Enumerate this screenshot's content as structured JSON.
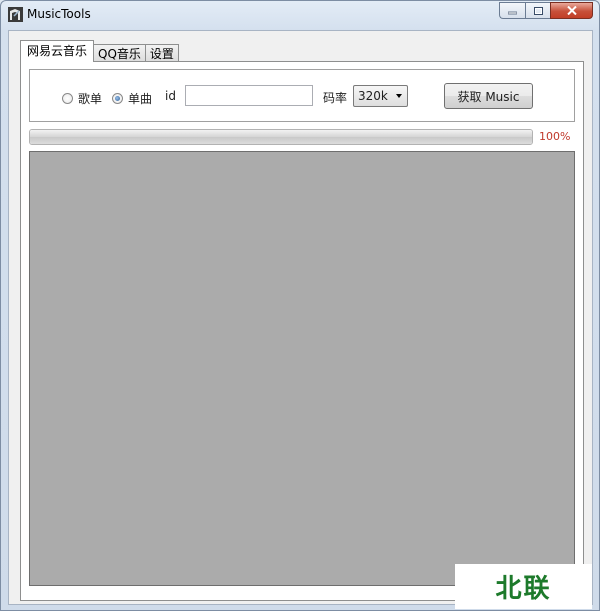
{
  "window": {
    "title": "MusicTools"
  },
  "tabs": [
    {
      "label": "网易云音乐",
      "active": true
    },
    {
      "label": "QQ音乐",
      "active": false
    },
    {
      "label": "设置",
      "active": false
    }
  ],
  "form": {
    "radio_playlist": "歌单",
    "radio_single": "单曲",
    "selected_mode": "单曲",
    "id_label": "id",
    "id_value": "",
    "bitrate_label": "码率",
    "bitrate_value": "320k",
    "fetch_button": "获取 Music"
  },
  "progress": {
    "value": 100,
    "label": "100%"
  },
  "watermark": {
    "text": "北联"
  },
  "colors": {
    "progress_text": "#c0392b",
    "log_background": "#ababab",
    "watermark": "#1d7a2b"
  }
}
